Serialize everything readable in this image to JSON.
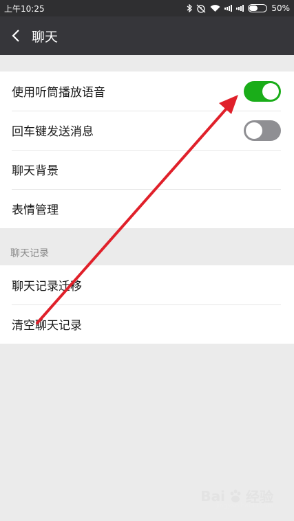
{
  "status_bar": {
    "time": "上午10:25",
    "battery": "50%",
    "battery_level": 0.5
  },
  "nav": {
    "title": "聊天"
  },
  "settings": {
    "group1": [
      {
        "label": "使用听筒播放语音",
        "toggle": "on"
      },
      {
        "label": "回车键发送消息",
        "toggle": "off"
      },
      {
        "label": "聊天背景"
      },
      {
        "label": "表情管理"
      }
    ],
    "section_title": "聊天记录",
    "group2": [
      {
        "label": "聊天记录迁移"
      },
      {
        "label": "清空聊天记录"
      }
    ]
  },
  "annotation": {
    "arrow_color": "#e0202a"
  },
  "watermark": {
    "brand": "Bai",
    "text": "经验",
    "url": "jingyan.baidu.com"
  },
  "colors": {
    "toggle_on": "#1aad19",
    "toggle_off": "#8f8f93",
    "nav_bg": "#36363a"
  }
}
